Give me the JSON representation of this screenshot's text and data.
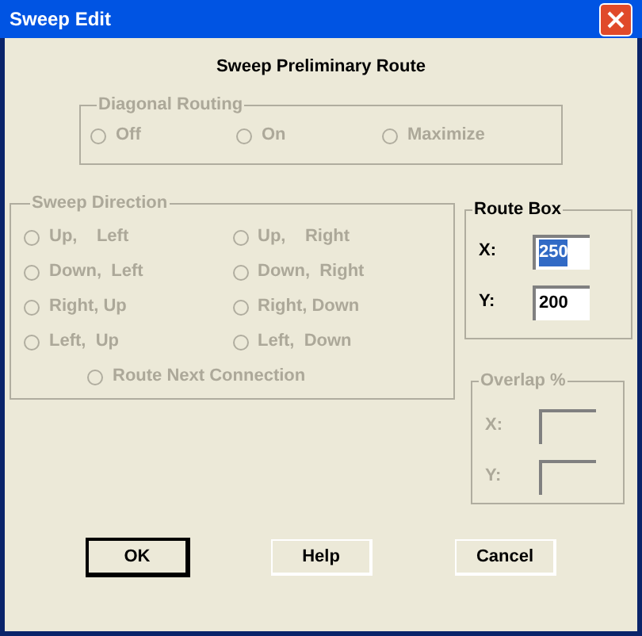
{
  "window": {
    "title": "Sweep Edit"
  },
  "heading": "Sweep Preliminary Route",
  "diagonal_routing": {
    "title": "Diagonal Routing",
    "disabled": true,
    "options": [
      {
        "label": "Off",
        "selected": false
      },
      {
        "label": "On",
        "selected": false
      },
      {
        "label": "Maximize",
        "selected": false
      }
    ]
  },
  "sweep_direction": {
    "title": "Sweep Direction",
    "disabled": true,
    "options": [
      {
        "label": "Up,    Left",
        "selected": false
      },
      {
        "label": "Up,    Right",
        "selected": false
      },
      {
        "label": "Down,  Left",
        "selected": false
      },
      {
        "label": "Down,  Right",
        "selected": false
      },
      {
        "label": "Right, Up",
        "selected": false
      },
      {
        "label": "Right, Down",
        "selected": false
      },
      {
        "label": "Left,  Up",
        "selected": false
      },
      {
        "label": "Left,  Down",
        "selected": false
      }
    ],
    "extra": {
      "label": "Route Next Connection",
      "selected": false
    }
  },
  "route_box": {
    "title": "Route Box",
    "disabled": false,
    "fields": [
      {
        "label": "X:",
        "value": "250",
        "selected": true
      },
      {
        "label": "Y:",
        "value": "200",
        "selected": false
      }
    ]
  },
  "overlap": {
    "title": "Overlap %",
    "disabled": true,
    "fields": [
      {
        "label": "X:"
      },
      {
        "label": "Y:"
      }
    ]
  },
  "buttons": [
    {
      "label": "OK",
      "default": true
    },
    {
      "label": "Help",
      "default": false
    },
    {
      "label": "Cancel",
      "default": false
    }
  ]
}
